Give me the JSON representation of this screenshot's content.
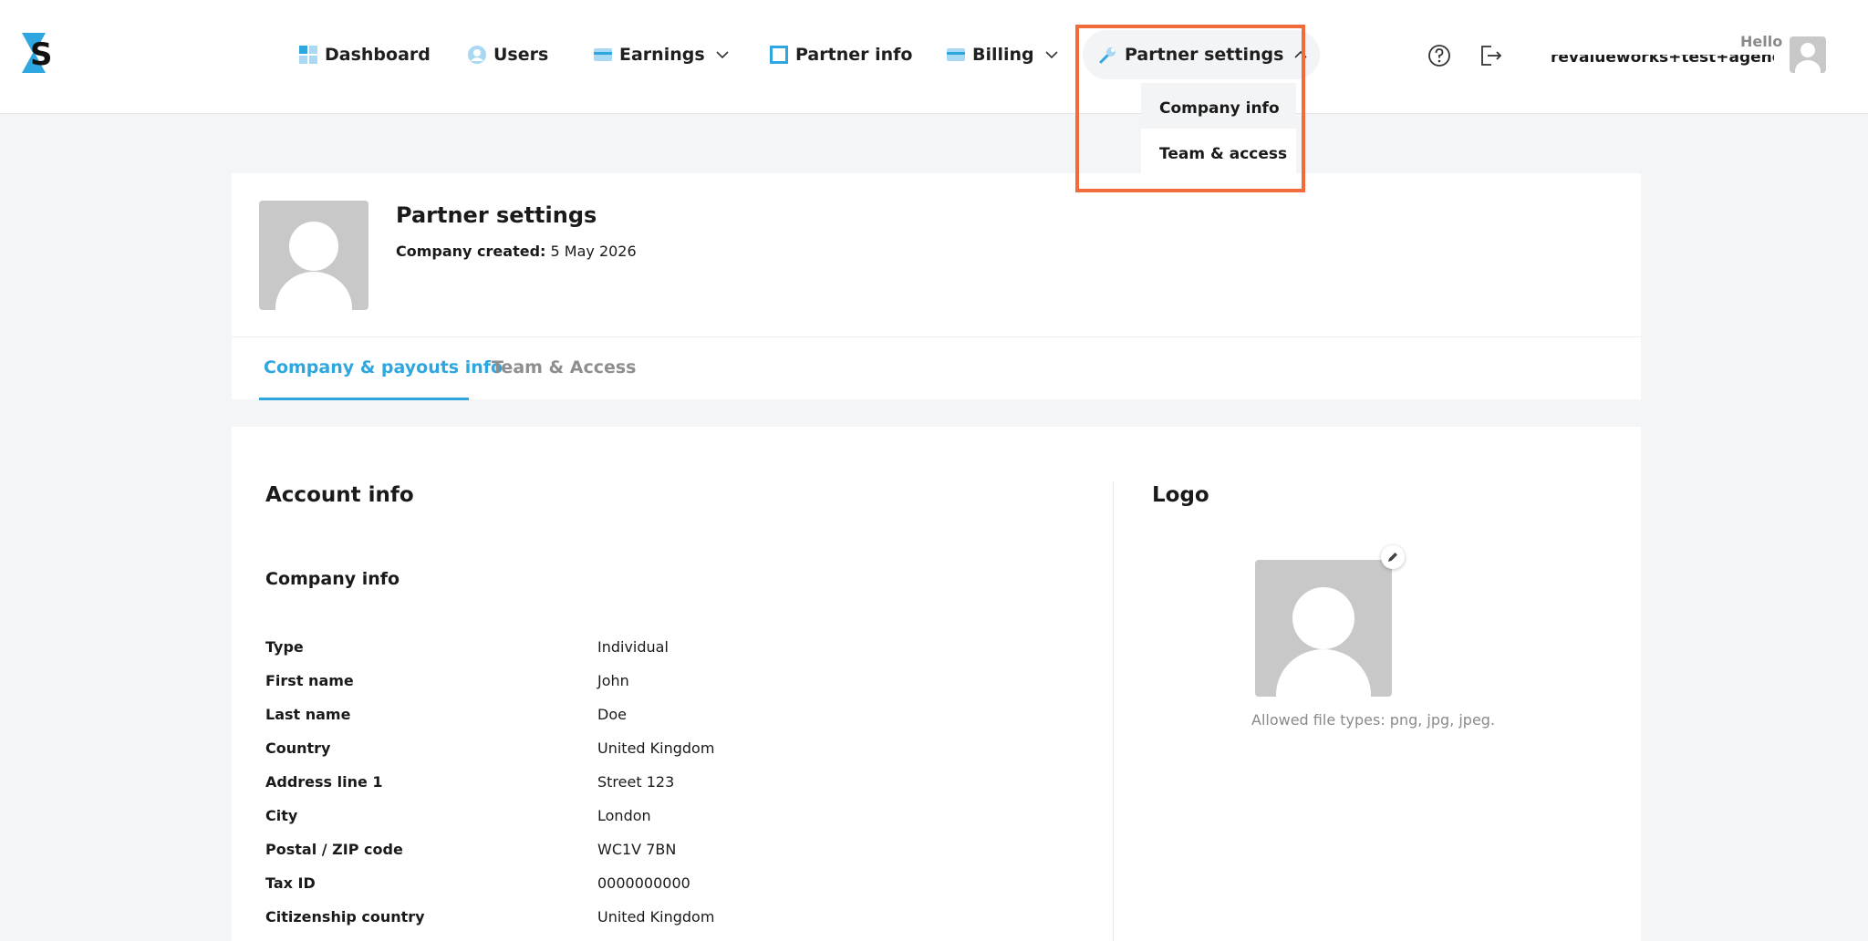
{
  "colors": {
    "accent": "#2ea7e0",
    "highlight": "#f26b3a",
    "placeholder": "#c8c8c8",
    "background": "#f4f5f6"
  },
  "nav": {
    "items": [
      {
        "label": "Dashboard",
        "icon": "dashboard-icon"
      },
      {
        "label": "Users",
        "icon": "users-icon"
      },
      {
        "label": "Earnings",
        "icon": "card-icon",
        "dropdown": true
      },
      {
        "label": "Partner info",
        "icon": "square-icon"
      },
      {
        "label": "Billing",
        "icon": "card-icon",
        "dropdown": true
      },
      {
        "label": "Partner settings",
        "icon": "wrench-icon",
        "dropdown": true,
        "open": true
      }
    ],
    "dropdown_items": [
      "Company info",
      "Team & access"
    ]
  },
  "user": {
    "greeting": "Hello",
    "email": "revalueworks+test+agency@..."
  },
  "header": {
    "title": "Partner settings",
    "created_label": "Company created:",
    "created_value": "5 May 2026",
    "tabs": [
      "Company & payouts info",
      "Team & Access"
    ]
  },
  "account": {
    "title": "Account info",
    "company_info_title": "Company info",
    "rows": [
      {
        "label": "Type",
        "value": "Individual"
      },
      {
        "label": "First name",
        "value": "John"
      },
      {
        "label": "Last name",
        "value": "Doe"
      },
      {
        "label": "Country",
        "value": "United Kingdom"
      },
      {
        "label": "Address line 1",
        "value": "Street 123"
      },
      {
        "label": "City",
        "value": "London"
      },
      {
        "label": "Postal / ZIP code",
        "value": "WC1V 7BN"
      },
      {
        "label": "Tax ID",
        "value": "0000000000"
      },
      {
        "label": "Citizenship country",
        "value": "United Kingdom"
      }
    ]
  },
  "logo_section": {
    "title": "Logo",
    "allowed_types": "Allowed file types: png, jpg, jpeg."
  }
}
